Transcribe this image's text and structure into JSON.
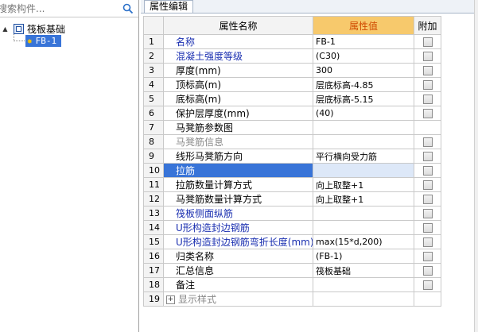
{
  "left": {
    "search": {
      "placeholder": "搜索构件..."
    },
    "tree": {
      "root": {
        "expander": "▲",
        "label": "筏板基础"
      },
      "child": {
        "label": "FB-1"
      }
    }
  },
  "tab": {
    "label": "属性编辑"
  },
  "grid": {
    "headers": {
      "name": "属性名称",
      "value": "属性值",
      "extra": "附加"
    },
    "rows": [
      {
        "num": "1",
        "name": "名称",
        "value": "FB-1",
        "check": true,
        "style": "blue"
      },
      {
        "num": "2",
        "name": "混凝土强度等级",
        "value": "(C30)",
        "check": true,
        "style": "blue"
      },
      {
        "num": "3",
        "name": "厚度(mm)",
        "value": "300",
        "check": true,
        "style": ""
      },
      {
        "num": "4",
        "name": "顶标高(m)",
        "value": "层底标高-4.85",
        "check": true,
        "style": ""
      },
      {
        "num": "5",
        "name": "底标高(m)",
        "value": "层底标高-5.15",
        "check": true,
        "style": ""
      },
      {
        "num": "6",
        "name": "保护层厚度(mm)",
        "value": "(40)",
        "check": true,
        "style": ""
      },
      {
        "num": "7",
        "name": "马凳筋参数图",
        "value": "",
        "check": false,
        "style": ""
      },
      {
        "num": "8",
        "name": "马凳筋信息",
        "value": "",
        "check": true,
        "style": "gray"
      },
      {
        "num": "9",
        "name": "线形马凳筋方向",
        "value": "平行横向受力筋",
        "check": true,
        "style": ""
      },
      {
        "num": "10",
        "name": "拉筋",
        "value": "",
        "check": true,
        "style": "sel"
      },
      {
        "num": "11",
        "name": "拉筋数量计算方式",
        "value": "向上取整+1",
        "check": true,
        "style": ""
      },
      {
        "num": "12",
        "name": "马凳筋数量计算方式",
        "value": "向上取整+1",
        "check": true,
        "style": ""
      },
      {
        "num": "13",
        "name": "筏板侧面纵筋",
        "value": "",
        "check": true,
        "style": "blue"
      },
      {
        "num": "14",
        "name": "U形构造封边钢筋",
        "value": "",
        "check": true,
        "style": "blue"
      },
      {
        "num": "15",
        "name": "U形构造封边钢筋弯折长度(mm)",
        "value": "max(15*d,200)",
        "check": true,
        "style": "blue"
      },
      {
        "num": "16",
        "name": "归类名称",
        "value": "(FB-1)",
        "check": true,
        "style": ""
      },
      {
        "num": "17",
        "name": "汇总信息",
        "value": "筏板基础",
        "check": true,
        "style": ""
      },
      {
        "num": "18",
        "name": "备注",
        "value": "",
        "check": true,
        "style": ""
      },
      {
        "num": "19",
        "name": "显示样式",
        "value": "",
        "check": false,
        "style": "gray",
        "expand": "+"
      }
    ]
  }
}
